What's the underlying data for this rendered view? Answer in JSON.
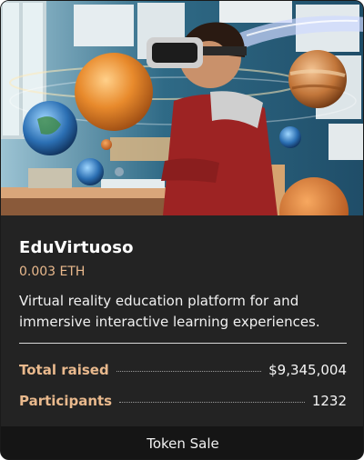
{
  "card": {
    "image_alt": "Child wearing a VR headset surrounded by planets in a classroom",
    "title": "EduVirtuoso",
    "price": "0.003 ETH",
    "description": "Virtual reality education platform for  and immersive interactive learning experiences.",
    "stats": [
      {
        "label": "Total raised",
        "value": "$9,345,004"
      },
      {
        "label": "Participants",
        "value": "1232"
      }
    ],
    "footer_label": "Token Sale"
  },
  "colors": {
    "card_bg": "#232323",
    "accent": "#e9b98d",
    "footer_bg": "#151515",
    "text": "#ffffff"
  }
}
